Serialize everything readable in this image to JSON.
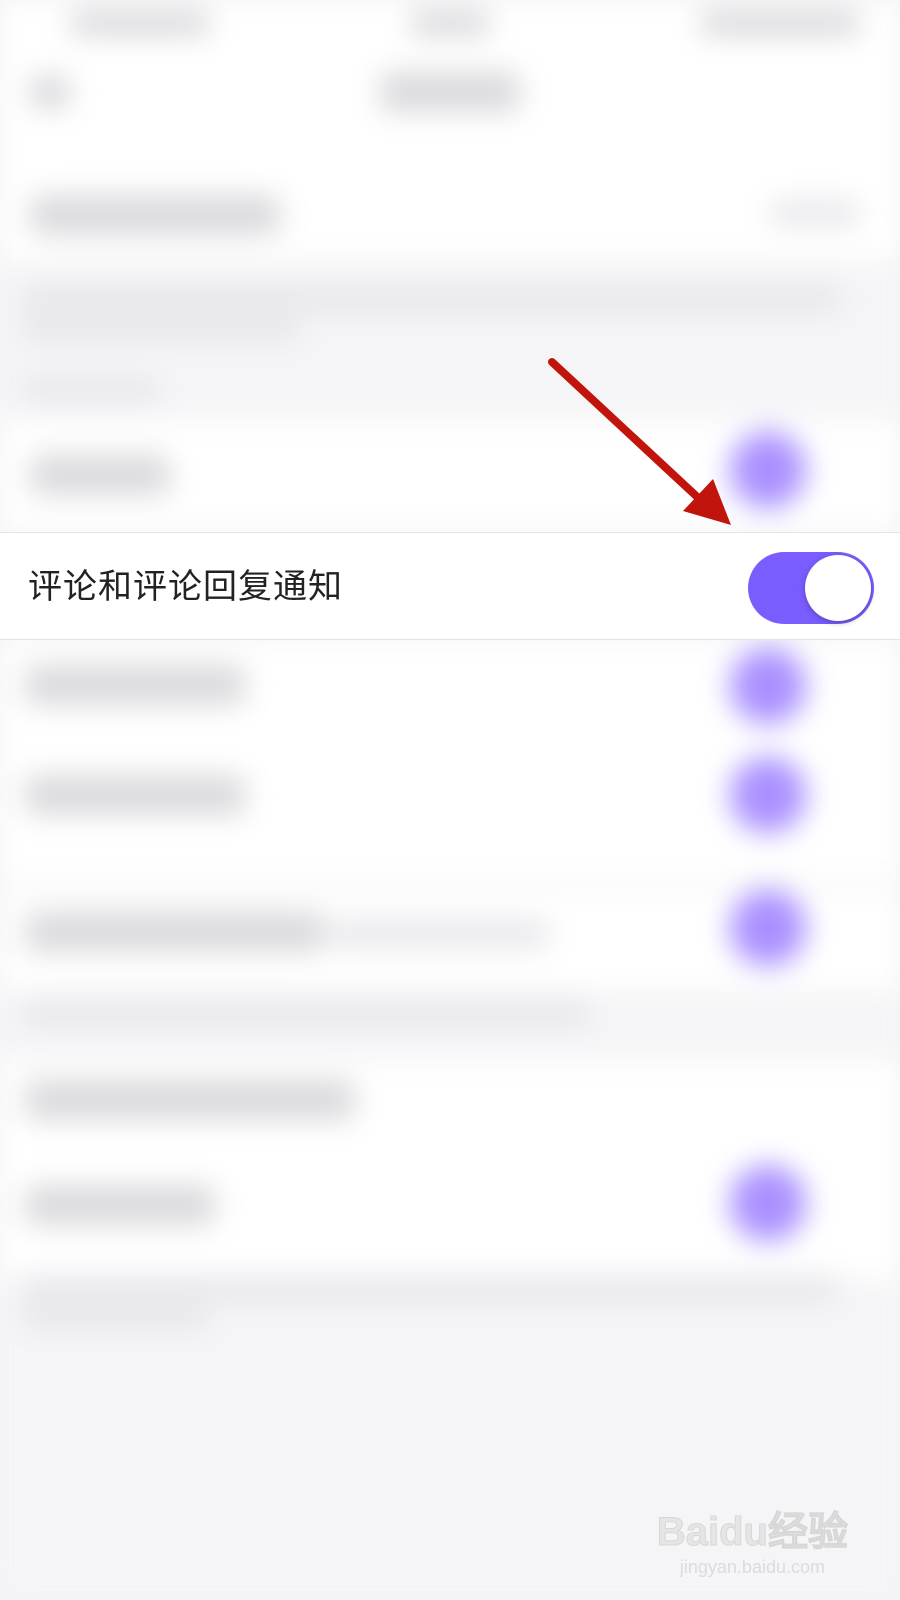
{
  "settings": {
    "focused_row": {
      "label": "评论和评论回复通知",
      "toggle_on": true
    }
  },
  "colors": {
    "accent": "#7a5cff",
    "annotation_arrow": "#c0140c",
    "row_background": "#ffffff",
    "page_background": "#f4f4f6"
  },
  "watermark": {
    "logo": "Baidu经验",
    "url": "jingyan.baidu.com"
  }
}
